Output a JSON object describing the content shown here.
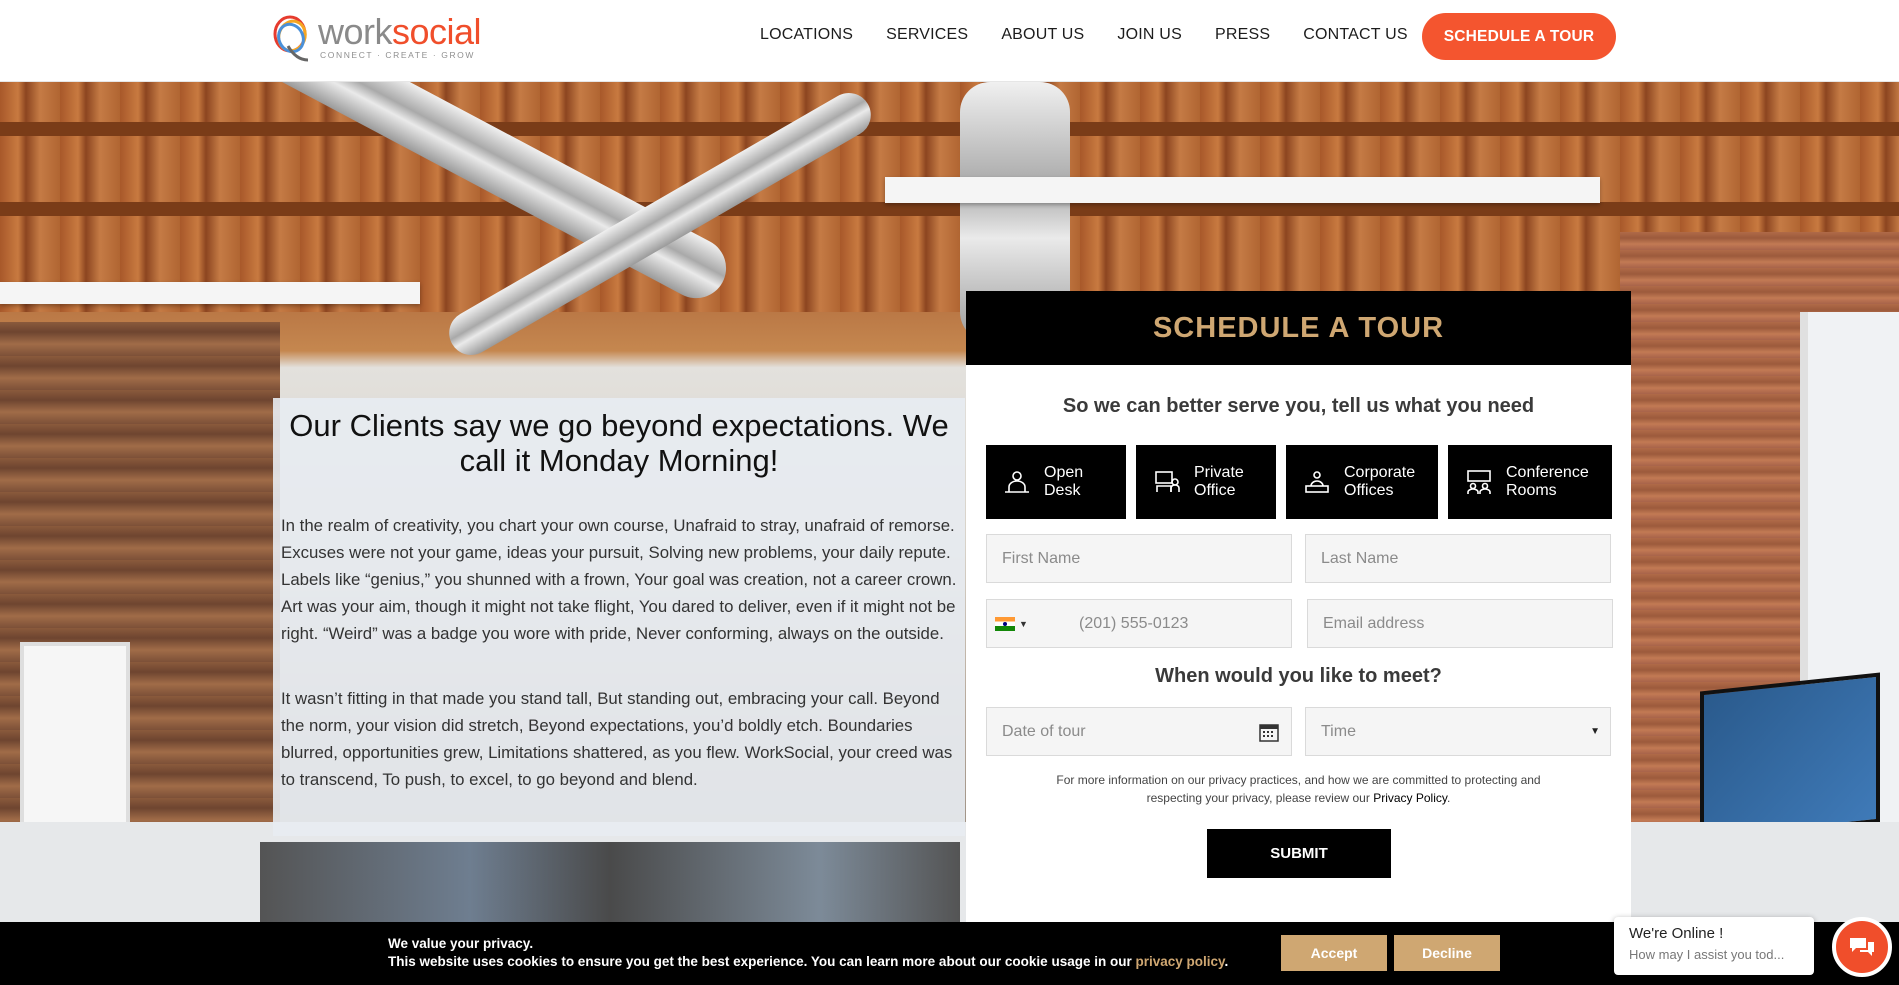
{
  "header": {
    "logo": {
      "word1": "work",
      "word2": "social",
      "tagline": "CONNECT · CREATE · GROW"
    },
    "nav": [
      "LOCATIONS",
      "SERVICES",
      "ABOUT US",
      "JOIN US",
      "PRESS",
      "CONTACT US"
    ],
    "cta_label": "SCHEDULE A TOUR"
  },
  "quote": {
    "title": "Our Clients say we go beyond expectations. We call it Monday Morning!",
    "paragraphs": [
      "In the realm of creativity, you chart your own course, Unafraid to stray, unafraid of remorse. Excuses were not your game, ideas your pursuit, Solving new problems, your daily repute. Labels like “genius,” you shunned with a frown, Your goal was creation, not a career crown. Art was your aim, though it might not take flight, You dared to deliver, even if it might not be right. “Weird” was a badge you wore with pride, Never conforming, always on the outside.",
      "It wasn’t fitting in that made you stand tall, But standing out, embracing your call. Beyond the norm, your vision did stretch, Beyond expectations, you’d boldly etch. Boundaries blurred, opportunities grew, Limitations shattered, as you flew. WorkSocial, your creed was to transcend, To push, to excel, to go beyond and blend."
    ]
  },
  "form": {
    "heading": "SCHEDULE A TOUR",
    "subheading": "So we can better serve you, tell us what you need",
    "types": [
      {
        "label": "Open\nDesk",
        "icon": "desk-icon"
      },
      {
        "label": "Private\nOffice",
        "icon": "office-icon"
      },
      {
        "label": "Corporate\nOffices",
        "icon": "building-icon"
      },
      {
        "label": "Conference\nRooms",
        "icon": "conference-icon"
      }
    ],
    "first_name_placeholder": "First Name",
    "last_name_placeholder": "Last Name",
    "phone_placeholder": "(201) 555-0123",
    "email_placeholder": "Email address",
    "meet_heading": "When would you like to meet?",
    "date_placeholder": "Date of tour",
    "time_placeholder": "Time",
    "privacy_text": "For more information on our privacy practices, and how we are committed to protecting and respecting your privacy, please review our",
    "privacy_link": "Privacy Policy",
    "submit_label": "SUBMIT"
  },
  "cookie": {
    "line1": "We value your privacy.",
    "line2": "This website uses cookies to ensure you get the best experience. You can learn more about our cookie usage in our",
    "link": "privacy policy",
    "accept": "Accept",
    "decline": "Decline"
  },
  "chat": {
    "title": "We're Online !",
    "subtitle": "How may I assist you tod..."
  },
  "colors": {
    "accent": "#f4552f",
    "gold": "#cfa772",
    "black": "#000000"
  }
}
